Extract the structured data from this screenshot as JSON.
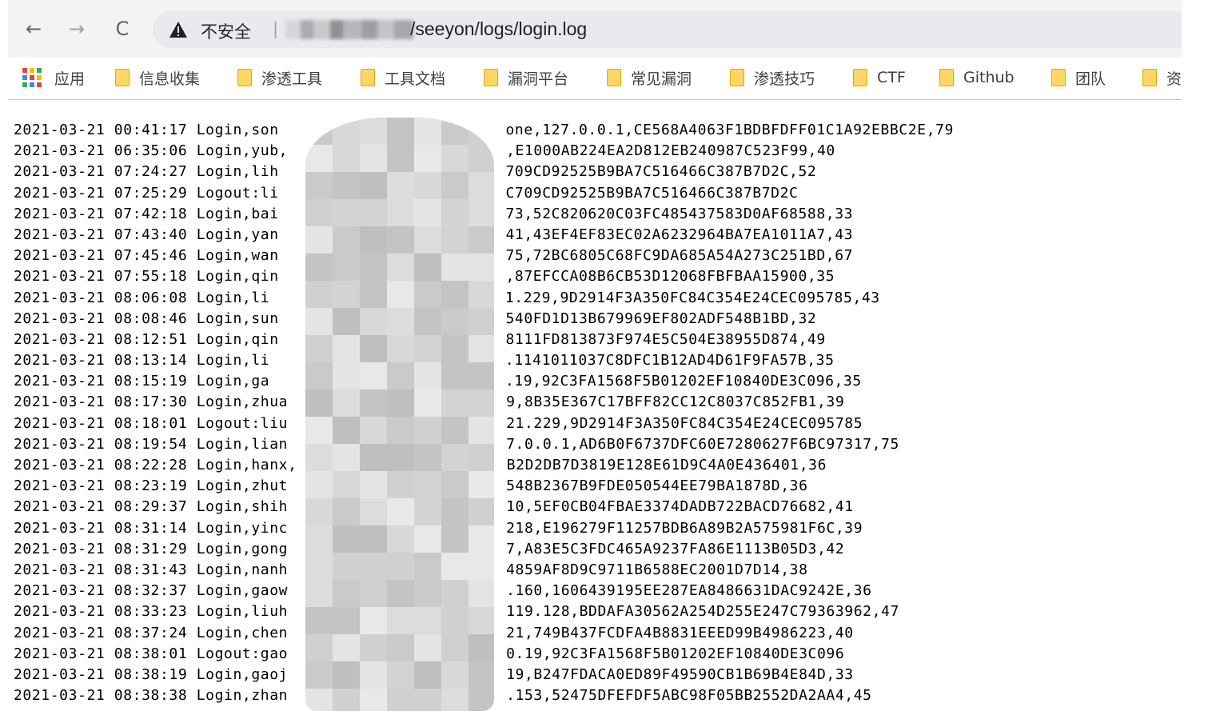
{
  "browser": {
    "nav": {
      "back": "←",
      "forward": "→",
      "reload": "C"
    },
    "address_bar": {
      "security_label": "不安全",
      "separator": "|",
      "url_path": "/seeyon/logs/login.log"
    },
    "bookmarks": [
      {
        "label": "应用",
        "icon": "apps-grid-icon"
      },
      {
        "label": "信息收集",
        "icon": "folder-icon"
      },
      {
        "label": "渗透工具",
        "icon": "folder-icon"
      },
      {
        "label": "工具文档",
        "icon": "folder-icon"
      },
      {
        "label": "漏洞平台",
        "icon": "folder-icon"
      },
      {
        "label": "常见漏洞",
        "icon": "folder-icon"
      },
      {
        "label": "渗透技巧",
        "icon": "folder-icon"
      },
      {
        "label": "CTF",
        "icon": "folder-icon"
      },
      {
        "label": "Github",
        "icon": "folder-icon"
      },
      {
        "label": "团队",
        "icon": "folder-icon"
      },
      {
        "label": "资",
        "icon": "folder-icon"
      }
    ]
  },
  "log_lines": [
    "2021-03-21 00:41:17 Login,son",
    "2021-03-21 06:35:06 Login,yub,",
    "2021-03-21 07:24:27 Login,lih",
    "2021-03-21 07:25:29 Logout:li",
    "2021-03-21 07:42:18 Login,bai",
    "2021-03-21 07:43:40 Login,yan",
    "2021-03-21 07:45:46 Login,wan",
    "2021-03-21 07:55:18 Login,qin",
    "2021-03-21 08:06:08 Login,li",
    "2021-03-21 08:08:46 Login,sun",
    "2021-03-21 08:12:51 Login,qin",
    "2021-03-21 08:13:14 Login,li",
    "2021-03-21 08:15:19 Login,ga",
    "2021-03-21 08:17:30 Login,zhua",
    "2021-03-21 08:18:01 Logout:liu",
    "2021-03-21 08:19:54 Login,lian",
    "2021-03-21 08:22:28 Login,hanx,",
    "2021-03-21 08:23:19 Login,zhut",
    "2021-03-21 08:29:37 Login,shih",
    "2021-03-21 08:31:14 Login,yinc",
    "2021-03-21 08:31:29 Login,gong",
    "2021-03-21 08:31:43 Login,nanh",
    "2021-03-21 08:32:37 Login,gaow",
    "2021-03-21 08:33:23 Login,liuh",
    "2021-03-21 08:37:24 Login,chen",
    "2021-03-21 08:38:01 Logout:gao",
    "2021-03-21 08:38:19 Login,gaoj",
    "2021-03-21 08:38:38 Login,zhan"
  ],
  "log_tails": [
    "one,127.0.0.1,CE568A4063F1BDBFDFF01C1A92EBBC2E,79",
    ",E1000AB224EA2D812EB240987C523F99,40",
    "709CD92525B9BA7C516466C387B7D2C,52",
    "C709CD92525B9BA7C516466C387B7D2C",
    "73,52C820620C03FC485437583D0AF68588,33",
    "41,43EF4EF83EC02A6232964BA7EA1011A7,43",
    "75,72BC6805C68FC9DA685A54A273C251BD,67",
    ",87EFCCA08B6CB53D12068FBFBAA15900,35",
    "1.229,9D2914F3A350FC84C354E24CEC095785,43",
    "540FD1D13B679969EF802ADF548B1BD,32",
    "8111FD813873F974E5C504E38955D874,49",
    ".1141011037C8DFC1B12AD4D61F9FA57B,35",
    ".19,92C3FA1568F5B01202EF10840DE3C096,35",
    "9,8B35E367C17BFF82CC12C8037C852FB1,39",
    "21.229,9D2914F3A350FC84C354E24CEC095785",
    "7.0.0.1,AD6B0F6737DFC60E7280627F6BC97317,75",
    "B2D2DB7D3819E128E61D9C4A0E436401,36",
    "548B2367B9FDE050544EE79BA1878D,36",
    "10,5EF0CB04FBAE3374DADB722BACD76682,41",
    "218,E196279F11257BDB6A89B2A575981F6C,39",
    "7,A83E5C3FDC465A9237FA86E1113B05D3,42",
    "4859AF8D9C9711B6588EC2001D7D14,38",
    ".160,1606439195EE287EA8486631DAC9242E,36",
    "119.128,BDDAFA30562A254D255E247C79363962,47",
    "21,749B437FCDFA4B8831EEED99B4986223,40",
    "0.19,92C3FA1568F5B01202EF10840DE3C096",
    "19,B247FDACA0ED89F49590CB1B69B4E84D,33",
    ".153,52475DFEFDF5ABC98F05BB2552DA2AA4,45"
  ]
}
